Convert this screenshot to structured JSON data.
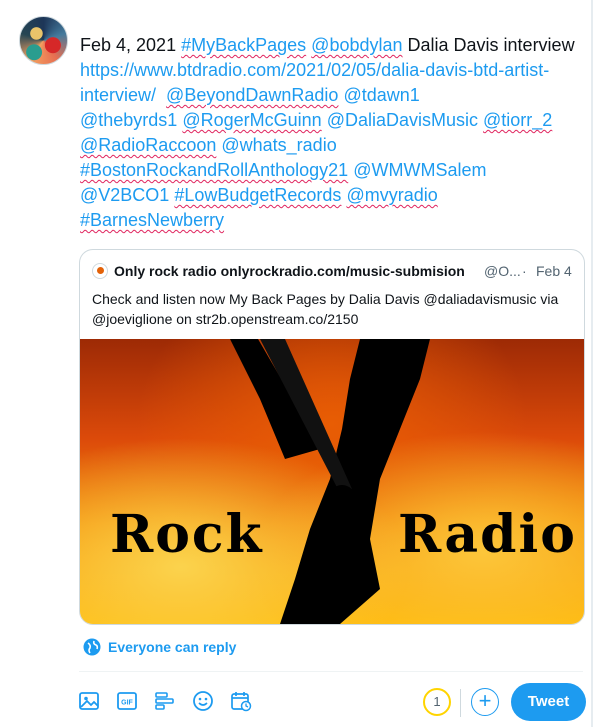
{
  "tweet": {
    "date": "Feb 4, 2021",
    "tag_mybackpages": "#MyBackPages",
    "mention_bobdylan": "@bobdylan",
    "text_dalia_interview": " Dalia Davis interview ",
    "link_url": "https://www.btdradio.com/2021/02/05/dalia-davis-btd-artist-interview/",
    "mention_beyonddawnradio": "@BeyondDawnRadio",
    "mention_tdawn1": "@tdawn1",
    "mention_thebyrds1": "@thebyrds1",
    "mention_rogermcguinn": "@RogerMcGuinn",
    "mention_daliadavismusic": "@DaliaDavisMusic",
    "mention_tiorr_2": "@tiorr_2",
    "mention_radioraccoon": "@RadioRaccoon",
    "mention_whats_radio": "@whats_radio",
    "tag_bostonrock": "#BostonRockandRollAnthology21",
    "mention_wmwmsalem": "@WMWMSalem",
    "mention_v2bco1": "@V2BCO1",
    "tag_lowbudget": "#LowBudgetRecords",
    "mention_mvyradio": "@mvyradio",
    "tag_barnesnewberry": "#BarnesNewberry"
  },
  "quote": {
    "name": "Only rock radio onlyrockradio.com/music-submision",
    "handle": "@O...",
    "dot": "·",
    "date": "Feb 4",
    "body": "Check and listen now My Back Pages by Dalia Davis @daliadavismusic via @joeviglione on str2b.openstream.co/2150",
    "media_word_left": "Rock",
    "media_word_right": "Radio"
  },
  "reply_setting": "Everyone can reply",
  "composer": {
    "icons": [
      "image-icon",
      "gif-icon",
      "poll-icon",
      "emoji-icon",
      "schedule-icon"
    ],
    "counter": "1",
    "add_symbol": "+",
    "tweet_label": "Tweet"
  },
  "colors": {
    "accent": "#1d9bf0",
    "text": "#0f1419",
    "muted": "#536471",
    "counter_ring": "#ffd400"
  }
}
